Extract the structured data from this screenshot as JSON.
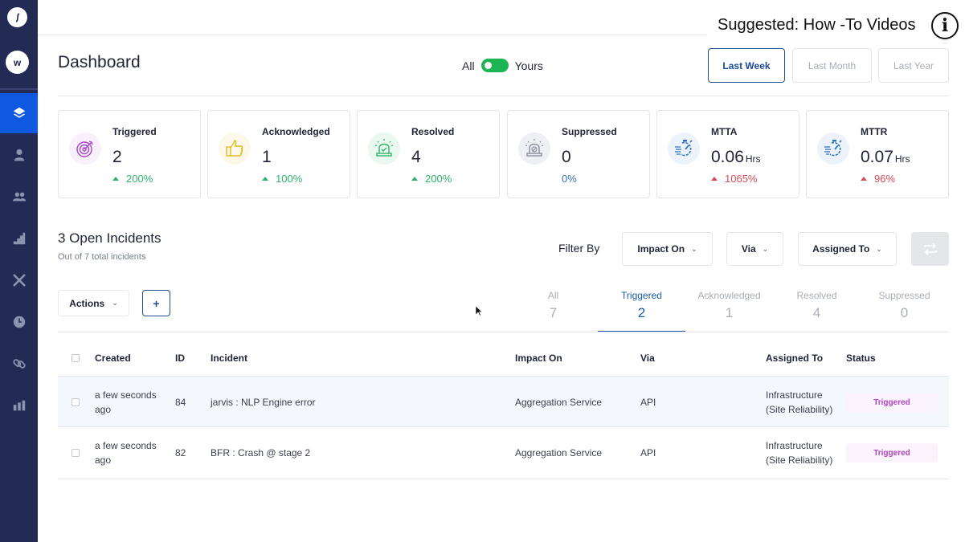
{
  "sidebar": {
    "logo": "brand-logo",
    "workspace_initial": "w",
    "items": [
      {
        "icon": "layers-icon",
        "active": true
      },
      {
        "icon": "user-icon",
        "active": false
      },
      {
        "icon": "users-icon",
        "active": false
      },
      {
        "icon": "stairs-icon",
        "active": false
      },
      {
        "icon": "tools-icon",
        "active": false
      },
      {
        "icon": "clock-icon",
        "active": false
      },
      {
        "icon": "link-icon",
        "active": false
      },
      {
        "icon": "bar-chart-icon",
        "active": false
      }
    ]
  },
  "overlay": {
    "suggested": "Suggested: How -To Videos",
    "info_glyph": "i"
  },
  "header": {
    "title": "Dashboard",
    "toggle_left": "All",
    "toggle_right": "Yours",
    "toggle_on": true,
    "ranges": [
      {
        "label": "Last Week",
        "active": true
      },
      {
        "label": "Last Month",
        "active": false
      },
      {
        "label": "Last Year",
        "active": false
      }
    ]
  },
  "cards": [
    {
      "label": "Triggered",
      "value": "2",
      "unit": "",
      "change": "200%",
      "trend": "up-green",
      "icon": "target-icon"
    },
    {
      "label": "Acknowledged",
      "value": "1",
      "unit": "",
      "change": "100%",
      "trend": "up-green",
      "icon": "thumbs-up-icon"
    },
    {
      "label": "Resolved",
      "value": "4",
      "unit": "",
      "change": "200%",
      "trend": "up-green",
      "icon": "siren-check-icon"
    },
    {
      "label": "Suppressed",
      "value": "0",
      "unit": "",
      "change": "0%",
      "trend": "neutral",
      "icon": "siren-off-icon"
    },
    {
      "label": "MTTA",
      "value": "0.06",
      "unit": "Hrs",
      "change": "1065%",
      "trend": "up-red",
      "icon": "stopwatch-icon"
    },
    {
      "label": "MTTR",
      "value": "0.07",
      "unit": "Hrs",
      "change": "96%",
      "trend": "up-red",
      "icon": "stopwatch-icon"
    }
  ],
  "incidents": {
    "title": "3 Open Incidents",
    "subtitle": "Out of 7 total incidents",
    "filter_label": "Filter By",
    "filters": [
      "Impact On",
      "Via",
      "Assigned To"
    ],
    "actions_label": "Actions",
    "add_label": "+",
    "tabs": [
      {
        "label": "All",
        "count": "7",
        "active": false
      },
      {
        "label": "Triggered",
        "count": "2",
        "active": true
      },
      {
        "label": "Acknowledged",
        "count": "1",
        "active": false
      },
      {
        "label": "Resolved",
        "count": "4",
        "active": false
      },
      {
        "label": "Suppressed",
        "count": "0",
        "active": false
      }
    ],
    "columns": [
      "Created",
      "ID",
      "Incident",
      "Impact On",
      "Via",
      "Assigned To",
      "Status"
    ],
    "rows": [
      {
        "created_1": "a few seconds",
        "created_2": "ago",
        "id": "84",
        "incident": "jarvis : NLP Engine error",
        "impact": "Aggregation Service",
        "via": "API",
        "assigned_1": "Infrastructure",
        "assigned_2": "(Site Reliability)",
        "status": "Triggered"
      },
      {
        "created_1": "a few seconds",
        "created_2": "ago",
        "id": "82",
        "incident": "BFR : Crash @ stage 2",
        "impact": "Aggregation Service",
        "via": "API",
        "assigned_1": "Infrastructure",
        "assigned_2": "(Site Reliability)",
        "status": "Triggered"
      }
    ]
  }
}
